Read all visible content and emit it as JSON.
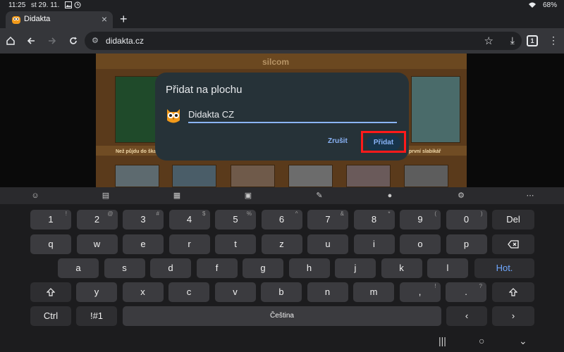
{
  "status": {
    "time": "11:25",
    "date": "st 29. 11.",
    "battery": "68%"
  },
  "tab": {
    "title": "Didakta",
    "close": "×",
    "new_tab": "+"
  },
  "toolbar": {
    "url": "didakta.cz",
    "tab_count": "1"
  },
  "page": {
    "logo": "silcom",
    "shelf_label_left": "Než půjdu do ška",
    "shelf_label_right": "j první slabikář"
  },
  "dialog": {
    "title": "Přidat na plochu",
    "name_value": "Didakta CZ",
    "cancel": "Zrušit",
    "confirm": "Přidat"
  },
  "keyboard": {
    "row1": [
      {
        "label": "1",
        "sup": "!"
      },
      {
        "label": "2",
        "sup": "@"
      },
      {
        "label": "3",
        "sup": "#"
      },
      {
        "label": "4",
        "sup": "$"
      },
      {
        "label": "5",
        "sup": "%"
      },
      {
        "label": "6",
        "sup": "^"
      },
      {
        "label": "7",
        "sup": "&"
      },
      {
        "label": "8",
        "sup": "*"
      },
      {
        "label": "9",
        "sup": "("
      },
      {
        "label": "0",
        "sup": ")"
      },
      {
        "label": "Del",
        "sup": ""
      }
    ],
    "row2": [
      "q",
      "w",
      "e",
      "r",
      "t",
      "z",
      "u",
      "i",
      "o",
      "p"
    ],
    "row3": [
      "a",
      "s",
      "d",
      "f",
      "g",
      "h",
      "j",
      "k",
      "l"
    ],
    "enter": "Hot.",
    "row4": [
      {
        "label": "y",
        "sup": ""
      },
      {
        "label": "x",
        "sup": ""
      },
      {
        "label": "c",
        "sup": ""
      },
      {
        "label": "v",
        "sup": ""
      },
      {
        "label": "b",
        "sup": ""
      },
      {
        "label": "n",
        "sup": ""
      },
      {
        "label": "m",
        "sup": ""
      },
      {
        "label": ",",
        "sup": "!"
      },
      {
        "label": ".",
        "sup": "?"
      }
    ],
    "ctrl": "Ctrl",
    "symbols": "!#1",
    "space": "Čeština"
  },
  "colors": {
    "accent": "#8ab4f8",
    "highlight": "#ff1a1a",
    "dialog_bg": "#263238"
  }
}
